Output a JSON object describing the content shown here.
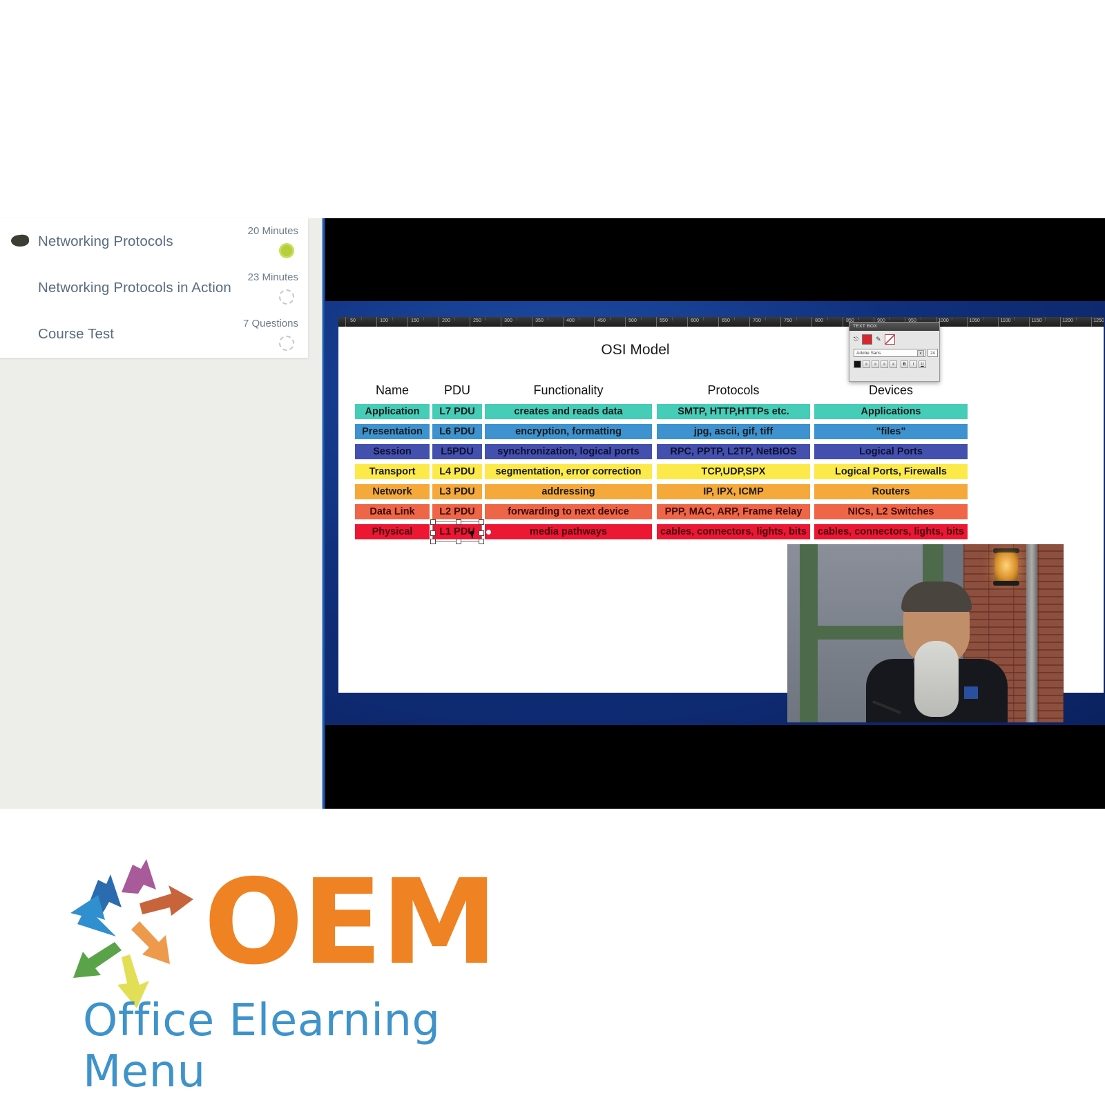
{
  "course_outline": {
    "items": [
      {
        "title": "Networking Protocols",
        "meta": "20 Minutes",
        "status": "completed",
        "bullet": true
      },
      {
        "title": "Networking Protocols in Action",
        "meta": "23 Minutes",
        "status": "pending",
        "bullet": false
      },
      {
        "title": "Course Test",
        "meta": "7 Questions",
        "status": "pending",
        "bullet": false
      }
    ]
  },
  "player": {
    "slide_title": "OSI Model",
    "toolbar": {
      "panel_title": "TEXT BOX",
      "font_name": "Adobe Sans",
      "font_size": "24",
      "bold_label": "B",
      "italic_label": "I",
      "underline_label": "U",
      "align_left_label": "≡",
      "align_center_label": "≡",
      "align_right_label": "≡",
      "align_justify_label": "≡",
      "dropdown_arrow": "▾",
      "swatch_fill": "#d9262e",
      "swatch_stroke": "#c94a55"
    },
    "selection": {
      "selected_cell": "L1 PDU"
    }
  },
  "chart_data": {
    "type": "table",
    "title": "OSI Model",
    "columns": [
      "Name",
      "PDU",
      "Functionality",
      "Protocols",
      "Devices"
    ],
    "rows": [
      {
        "name": "Application",
        "pdu": "L7 PDU",
        "functionality": "creates and reads data",
        "protocols": "SMTP, HTTP,HTTPs etc.",
        "devices": "Applications",
        "color": "#45cdb8"
      },
      {
        "name": "Presentation",
        "pdu": "L6 PDU",
        "functionality": "encryption, formatting",
        "protocols": "jpg, ascii, gif, tiff",
        "devices": "\"files\"",
        "color": "#3d92cf"
      },
      {
        "name": "Session",
        "pdu": "L5PDU",
        "functionality": "synchronization, logical ports",
        "protocols": "RPC, PPTP, L2TP, NetBIOS",
        "devices": "Logical Ports",
        "color": "#4450ae"
      },
      {
        "name": "Transport",
        "pdu": "L4 PDU",
        "functionality": "segmentation, error correction",
        "protocols": "TCP,UDP,SPX",
        "devices": "Logical Ports, Firewalls",
        "color": "#fcea4b"
      },
      {
        "name": "Network",
        "pdu": "L3 PDU",
        "functionality": "addressing",
        "protocols": "IP, IPX, ICMP",
        "devices": "Routers",
        "color": "#f6a93b"
      },
      {
        "name": "Data Link",
        "pdu": "L2 PDU",
        "functionality": "forwarding to next device",
        "protocols": "PPP, MAC, ARP, Frame Relay",
        "devices": "NICs, L2 Switches",
        "color": "#ef6547"
      },
      {
        "name": "Physical",
        "pdu": "L1 PDU",
        "functionality": "media pathways",
        "protocols": "cables, connectors, lights, bits",
        "devices": "cables, connectors, lights, bits",
        "color": "#ec1733"
      }
    ]
  },
  "branding": {
    "logo_text": "OEM",
    "tagline": "Office Elearning Menu",
    "accent_orange": "#ef8222",
    "accent_blue": "#3e93cb"
  }
}
